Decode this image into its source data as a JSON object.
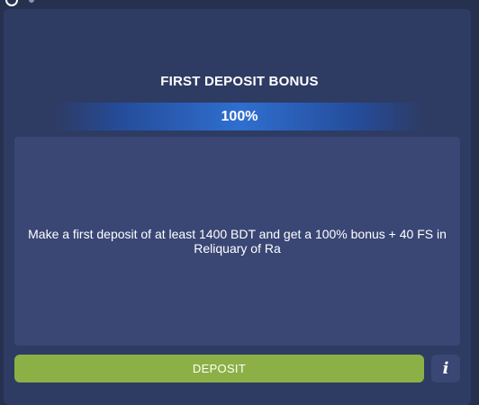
{
  "bonus": {
    "title": "FIRST DEPOSIT BONUS",
    "percent": "100%",
    "description": "Make a first deposit of at least 1400 BDT and get a 100% bonus + 40 FS in Reliquary of Ra"
  },
  "actions": {
    "deposit_label": "DEPOSIT",
    "info_icon": "i"
  },
  "colors": {
    "background": "#263150",
    "card": "#2e3b63",
    "panel": "#3a4775",
    "accent_blue": "#2f6fd0",
    "deposit_green": "#8cb045",
    "text": "#ffffff"
  },
  "icons": {
    "info": "info-icon"
  }
}
